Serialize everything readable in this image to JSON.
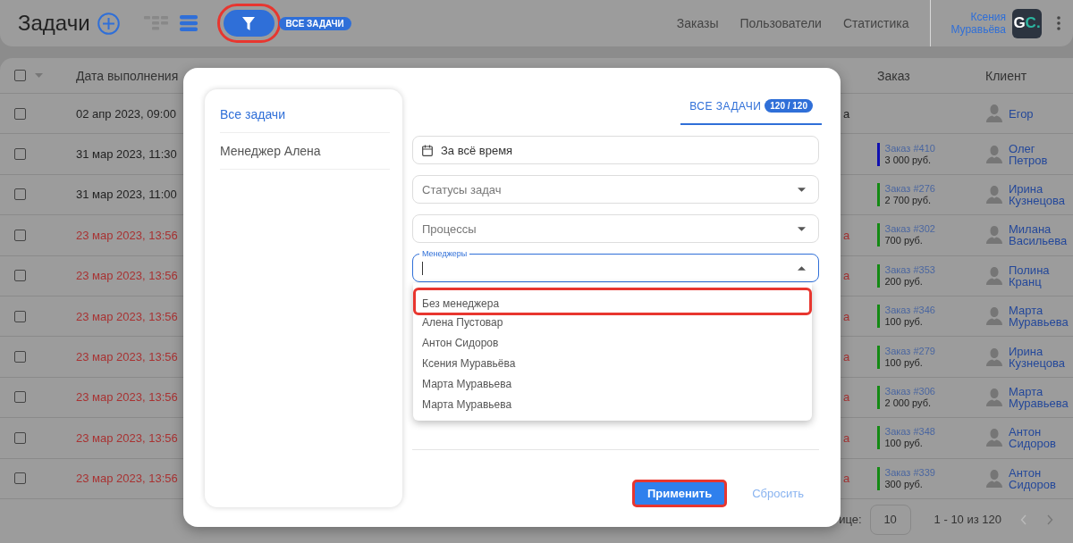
{
  "header": {
    "title": "Задачи",
    "filter_button": {
      "highlighted": true
    },
    "filter_badge": "ВСЕ ЗАДАЧИ",
    "nav": [
      "Заказы",
      "Пользователи",
      "Статистика"
    ],
    "user": {
      "first_name": "Ксения",
      "last_name": "Муравьёва"
    },
    "logo": [
      "G",
      "C."
    ]
  },
  "table": {
    "header_checked": false,
    "columns": [
      "Дата выполнения",
      "Заказ",
      "Клиент"
    ],
    "rows": [
      {
        "checked": false,
        "date": "02 апр 2023, 09:00",
        "overdue": false,
        "column_3": "а",
        "client_first": "Егор"
      },
      {
        "checked": false,
        "date": "31 мар 2023, 11:30",
        "overdue": false,
        "order": "Заказ #410",
        "amount": "3 000 руб.",
        "color": "#1010b0",
        "client_first": "Олег",
        "client_last": "Петров"
      },
      {
        "checked": false,
        "date": "31 мар 2023, 11:00",
        "overdue": false,
        "order": "Заказ #276",
        "amount": "2 700 руб.",
        "color": "#138a13",
        "client_first": "Ирина",
        "client_last": "Кузнецова"
      },
      {
        "checked": false,
        "date": "23 мар 2023, 13:56",
        "overdue": true,
        "column_3": "а",
        "order": "Заказ #302",
        "amount": "700 руб.",
        "color": "#138a13",
        "client_first": "Милана",
        "client_last": "Васильева"
      },
      {
        "checked": false,
        "date": "23 мар 2023, 13:56",
        "overdue": true,
        "column_3": "а",
        "order": "Заказ #353",
        "amount": "200 руб.",
        "color": "#138a13",
        "client_first": "Полина",
        "client_last": "Кранц"
      },
      {
        "checked": false,
        "date": "23 мар 2023, 13:56",
        "overdue": true,
        "column_3": "а",
        "order": "Заказ #346",
        "amount": "100 руб.",
        "color": "#138a13",
        "client_first": "Марта",
        "client_last": "Муравьева"
      },
      {
        "checked": false,
        "date": "23 мар 2023, 13:56",
        "overdue": true,
        "column_3": "а",
        "order": "Заказ #279",
        "amount": "100 руб.",
        "color": "#138a13",
        "client_first": "Ирина",
        "client_last": "Кузнецова"
      },
      {
        "checked": false,
        "date": "23 мар 2023, 13:56",
        "overdue": true,
        "column_3": "а",
        "order": "Заказ #306",
        "amount": "2 000 руб.",
        "color": "#138a13",
        "client_first": "Марта",
        "client_last": "Муравьева"
      },
      {
        "checked": false,
        "date": "23 мар 2023, 13:56",
        "overdue": true,
        "column_3": "а",
        "order": "Заказ #348",
        "amount": "100 руб.",
        "color": "#138a13",
        "client_first": "Антон",
        "client_last": "Сидоров"
      },
      {
        "checked": false,
        "date": "23 мар 2023, 13:56",
        "overdue": true,
        "column_3": "а",
        "order": "Заказ #339",
        "amount": "300 руб.",
        "color": "#138a13",
        "client_first": "Антон",
        "client_last": "Сидоров"
      }
    ],
    "footer": {
      "per_page_label": "ице:",
      "per_page": "10",
      "range": "1 - 10 из 120"
    }
  },
  "dialog": {
    "sidebar": [
      {
        "label": "Все задачи",
        "selected": true
      },
      {
        "label": "Менеджер Алена",
        "selected": false
      }
    ],
    "tab": {
      "label": "ВСЕ ЗАДАЧИ",
      "count": "120 / 120",
      "selected": true
    },
    "fields": [
      {
        "kind": "date",
        "value": "За всё время"
      },
      {
        "kind": "select",
        "placeholder": "Статусы задач",
        "expanded": false
      },
      {
        "kind": "select",
        "placeholder": "Процессы",
        "expanded": false
      },
      {
        "kind": "select",
        "label": "Менеджеры",
        "expanded": true,
        "options": [
          {
            "label": "Без менеджера",
            "highlighted": true
          },
          {
            "label": "Алена Пустовар",
            "highlighted": false
          },
          {
            "label": "Антон Сидоров",
            "highlighted": false
          },
          {
            "label": "Ксения Муравьёва",
            "highlighted": false
          },
          {
            "label": "Марта Муравьева",
            "highlighted": false
          },
          {
            "label": "Марта Муравьева",
            "highlighted": false
          }
        ]
      }
    ],
    "apply_button": {
      "label": "Применить",
      "highlighted": true
    },
    "reset_button": "Сбросить"
  }
}
